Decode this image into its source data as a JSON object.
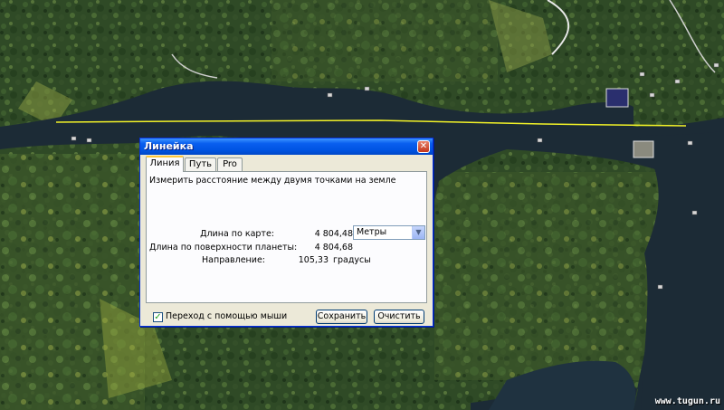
{
  "dialog": {
    "title": "Линейка",
    "close_glyph": "✕",
    "tabs": [
      {
        "label": "Линия",
        "active": true
      },
      {
        "label": "Путь",
        "active": false
      },
      {
        "label": "Pro",
        "active": false
      }
    ],
    "description": "Измерить расстояние между двумя точками на земле",
    "map_length": {
      "label": "Длина по карте:",
      "value": "4 804,48"
    },
    "unit_select": {
      "selected": "Метры"
    },
    "surface_length": {
      "label": "Длина по поверхности планеты:",
      "value": "4 804,68"
    },
    "direction": {
      "label": "Направление:",
      "value": "105,33",
      "unit": "градусы"
    },
    "mouse_nav": {
      "label": "Переход с помощью мыши",
      "checked": true
    },
    "save_label": "Сохранить",
    "clear_label": "Очистить"
  },
  "map": {
    "water_color": "#1c2b36",
    "ruler_color": "#f2f227"
  },
  "watermark": "www.tugun.ru"
}
